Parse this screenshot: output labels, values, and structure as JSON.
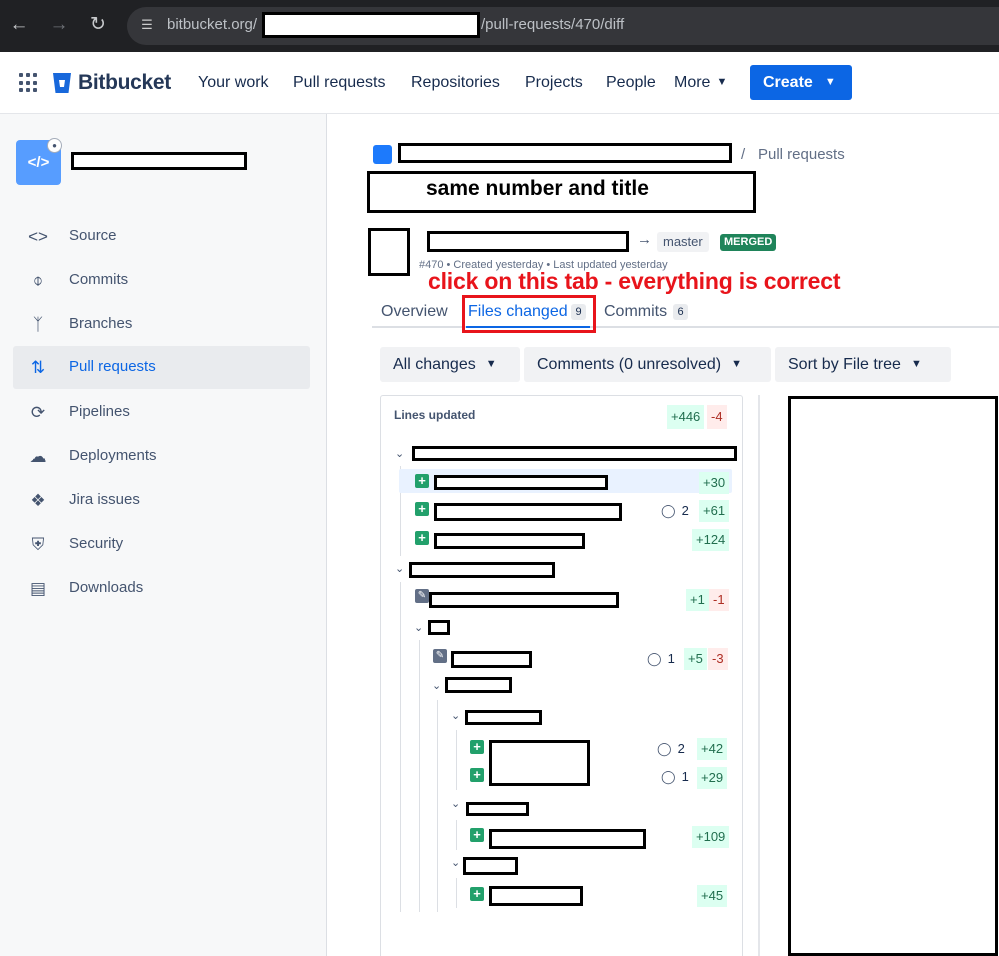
{
  "browser": {
    "url_host": "bitbucket.org/",
    "url_path": "/pull-requests/470/diff"
  },
  "topnav": {
    "product": "Bitbucket",
    "links": [
      "Your work",
      "Pull requests",
      "Repositories",
      "Projects",
      "People",
      "More"
    ],
    "create_label": "Create"
  },
  "sidebar": {
    "items": [
      {
        "label": "Source",
        "icon": "code-icon"
      },
      {
        "label": "Commits",
        "icon": "commit-icon"
      },
      {
        "label": "Branches",
        "icon": "branch-icon"
      },
      {
        "label": "Pull requests",
        "icon": "pull-request-icon",
        "active": true
      },
      {
        "label": "Pipelines",
        "icon": "pipelines-icon"
      },
      {
        "label": "Deployments",
        "icon": "deployments-icon"
      },
      {
        "label": "Jira issues",
        "icon": "jira-icon"
      },
      {
        "label": "Security",
        "icon": "shield-icon"
      },
      {
        "label": "Downloads",
        "icon": "file-icon"
      }
    ]
  },
  "breadcrumb": {
    "separator": "/",
    "section": "Pull requests"
  },
  "pr": {
    "title_note": "same number and title",
    "target_branch": "master",
    "status": "MERGED",
    "meta": "#470 • Created yesterday • Last updated yesterday"
  },
  "annotation": "click on this tab - everything is correct",
  "tabs": [
    {
      "label": "Overview",
      "active": false
    },
    {
      "label": "Files changed",
      "count": "9",
      "active": true
    },
    {
      "label": "Commits",
      "count": "6",
      "active": false
    }
  ],
  "filters": {
    "changes": "All changes",
    "comments": "Comments (0 unresolved)",
    "sort": "Sort by File tree"
  },
  "file_tree": {
    "header": "Lines updated",
    "total_added": "+446",
    "total_removed": "-4",
    "rows": [
      {
        "added": "+30"
      },
      {
        "comments": "2",
        "added": "+61"
      },
      {
        "added": "+124"
      },
      {
        "added": "+1",
        "removed": "-1"
      },
      {
        "comments": "1",
        "added": "+5",
        "removed": "-3"
      },
      {
        "comments": "2",
        "added": "+42"
      },
      {
        "comments": "1",
        "added": "+29"
      },
      {
        "added": "+109"
      },
      {
        "added": "+45"
      }
    ]
  },
  "colors": {
    "accent": "#0c66e4",
    "merged": "#1f845a",
    "annotation": "#e8141b"
  }
}
